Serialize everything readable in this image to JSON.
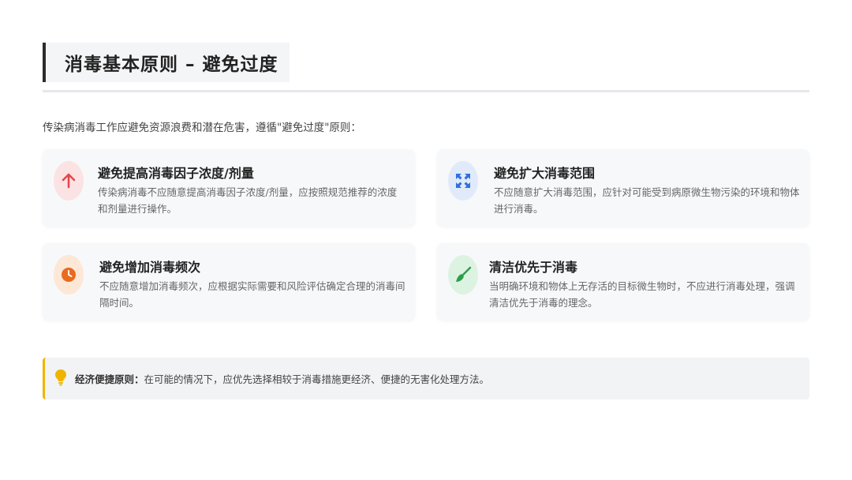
{
  "title": "消毒基本原则 – 避免过度",
  "intro": "传染病消毒工作应避免资源浪费和潜在危害，遵循\"避免过度\"原则：",
  "cards": [
    {
      "icon": "arrow-up-icon",
      "title": "避免提高消毒因子浓度/剂量",
      "desc": "传染病消毒不应随意提高消毒因子浓度/剂量，应按照规范推荐的浓度和剂量进行操作。",
      "icon_color": "#e5484d",
      "icon_bg": "#fbe3e4"
    },
    {
      "icon": "expand-arrows-icon",
      "title": "避免扩大消毒范围",
      "desc": "不应随意扩大消毒范围，应针对可能受到病原微生物污染的环境和物体进行消毒。",
      "icon_color": "#2f6fe0",
      "icon_bg": "#e1eafb"
    },
    {
      "icon": "clock-icon",
      "title": "避免增加消毒频次",
      "desc": "不应随意增加消毒频次，应根据实际需要和风险评估确定合理的消毒间隔时间。",
      "icon_color": "#ea6a1f",
      "icon_bg": "#fde7d6"
    },
    {
      "icon": "broom-icon",
      "title": "清洁优先于消毒",
      "desc": "当明确环境和物体上无存活的目标微生物时，不应进行消毒处理，强调清洁优先于消毒的理念。",
      "icon_color": "#2e9d4a",
      "icon_bg": "#dcf3e1"
    }
  ],
  "tip": {
    "icon": "lightbulb-icon",
    "label": "经济便捷原则：",
    "text": "在可能的情况下，应优先选择相较于消毒措施更经济、便捷的无害化处理方法。",
    "accent": "#f0b400"
  }
}
